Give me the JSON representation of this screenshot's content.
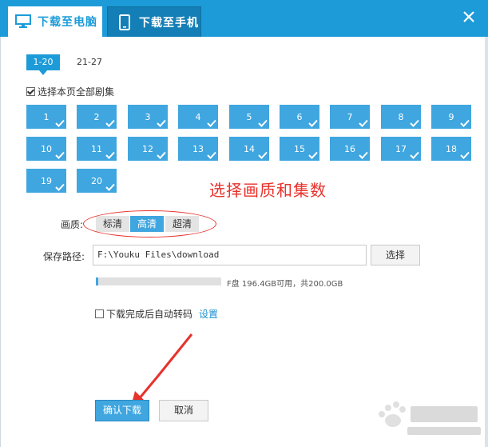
{
  "tabs": {
    "pc_label": "下载至电脑",
    "phone_label": "下载至手机"
  },
  "pagination": {
    "active": "1-20",
    "inactive": "21-27"
  },
  "select_all": {
    "label": "选择本页全部剧集",
    "checked": true
  },
  "episodes": [
    "1",
    "2",
    "3",
    "4",
    "5",
    "6",
    "7",
    "8",
    "9",
    "10",
    "11",
    "12",
    "13",
    "14",
    "15",
    "16",
    "17",
    "18",
    "19",
    "20"
  ],
  "annotation": "选择画质和集数",
  "quality": {
    "label": "画质:",
    "options": [
      "标清",
      "高清",
      "超清"
    ],
    "selected": "高清"
  },
  "save_path": {
    "label": "保存路径:",
    "value": "F:\\Youku Files\\download",
    "browse_label": "选择"
  },
  "disk": {
    "text": "F盘 196.4GB可用，共200.0GB",
    "used_fraction": 0.018
  },
  "transcode": {
    "label": "下载完成后自动转码",
    "checked": false,
    "settings_label": "设置"
  },
  "buttons": {
    "confirm": "确认下载",
    "cancel": "取消"
  },
  "colors": {
    "accent": "#1d9bd8",
    "episode": "#3fa6e0",
    "annotation": "#e8322c"
  },
  "icons": {
    "pc_tab": "monitor-icon",
    "phone_tab": "phone-icon",
    "close": "close-icon",
    "episode_check": "checkmark-icon"
  }
}
